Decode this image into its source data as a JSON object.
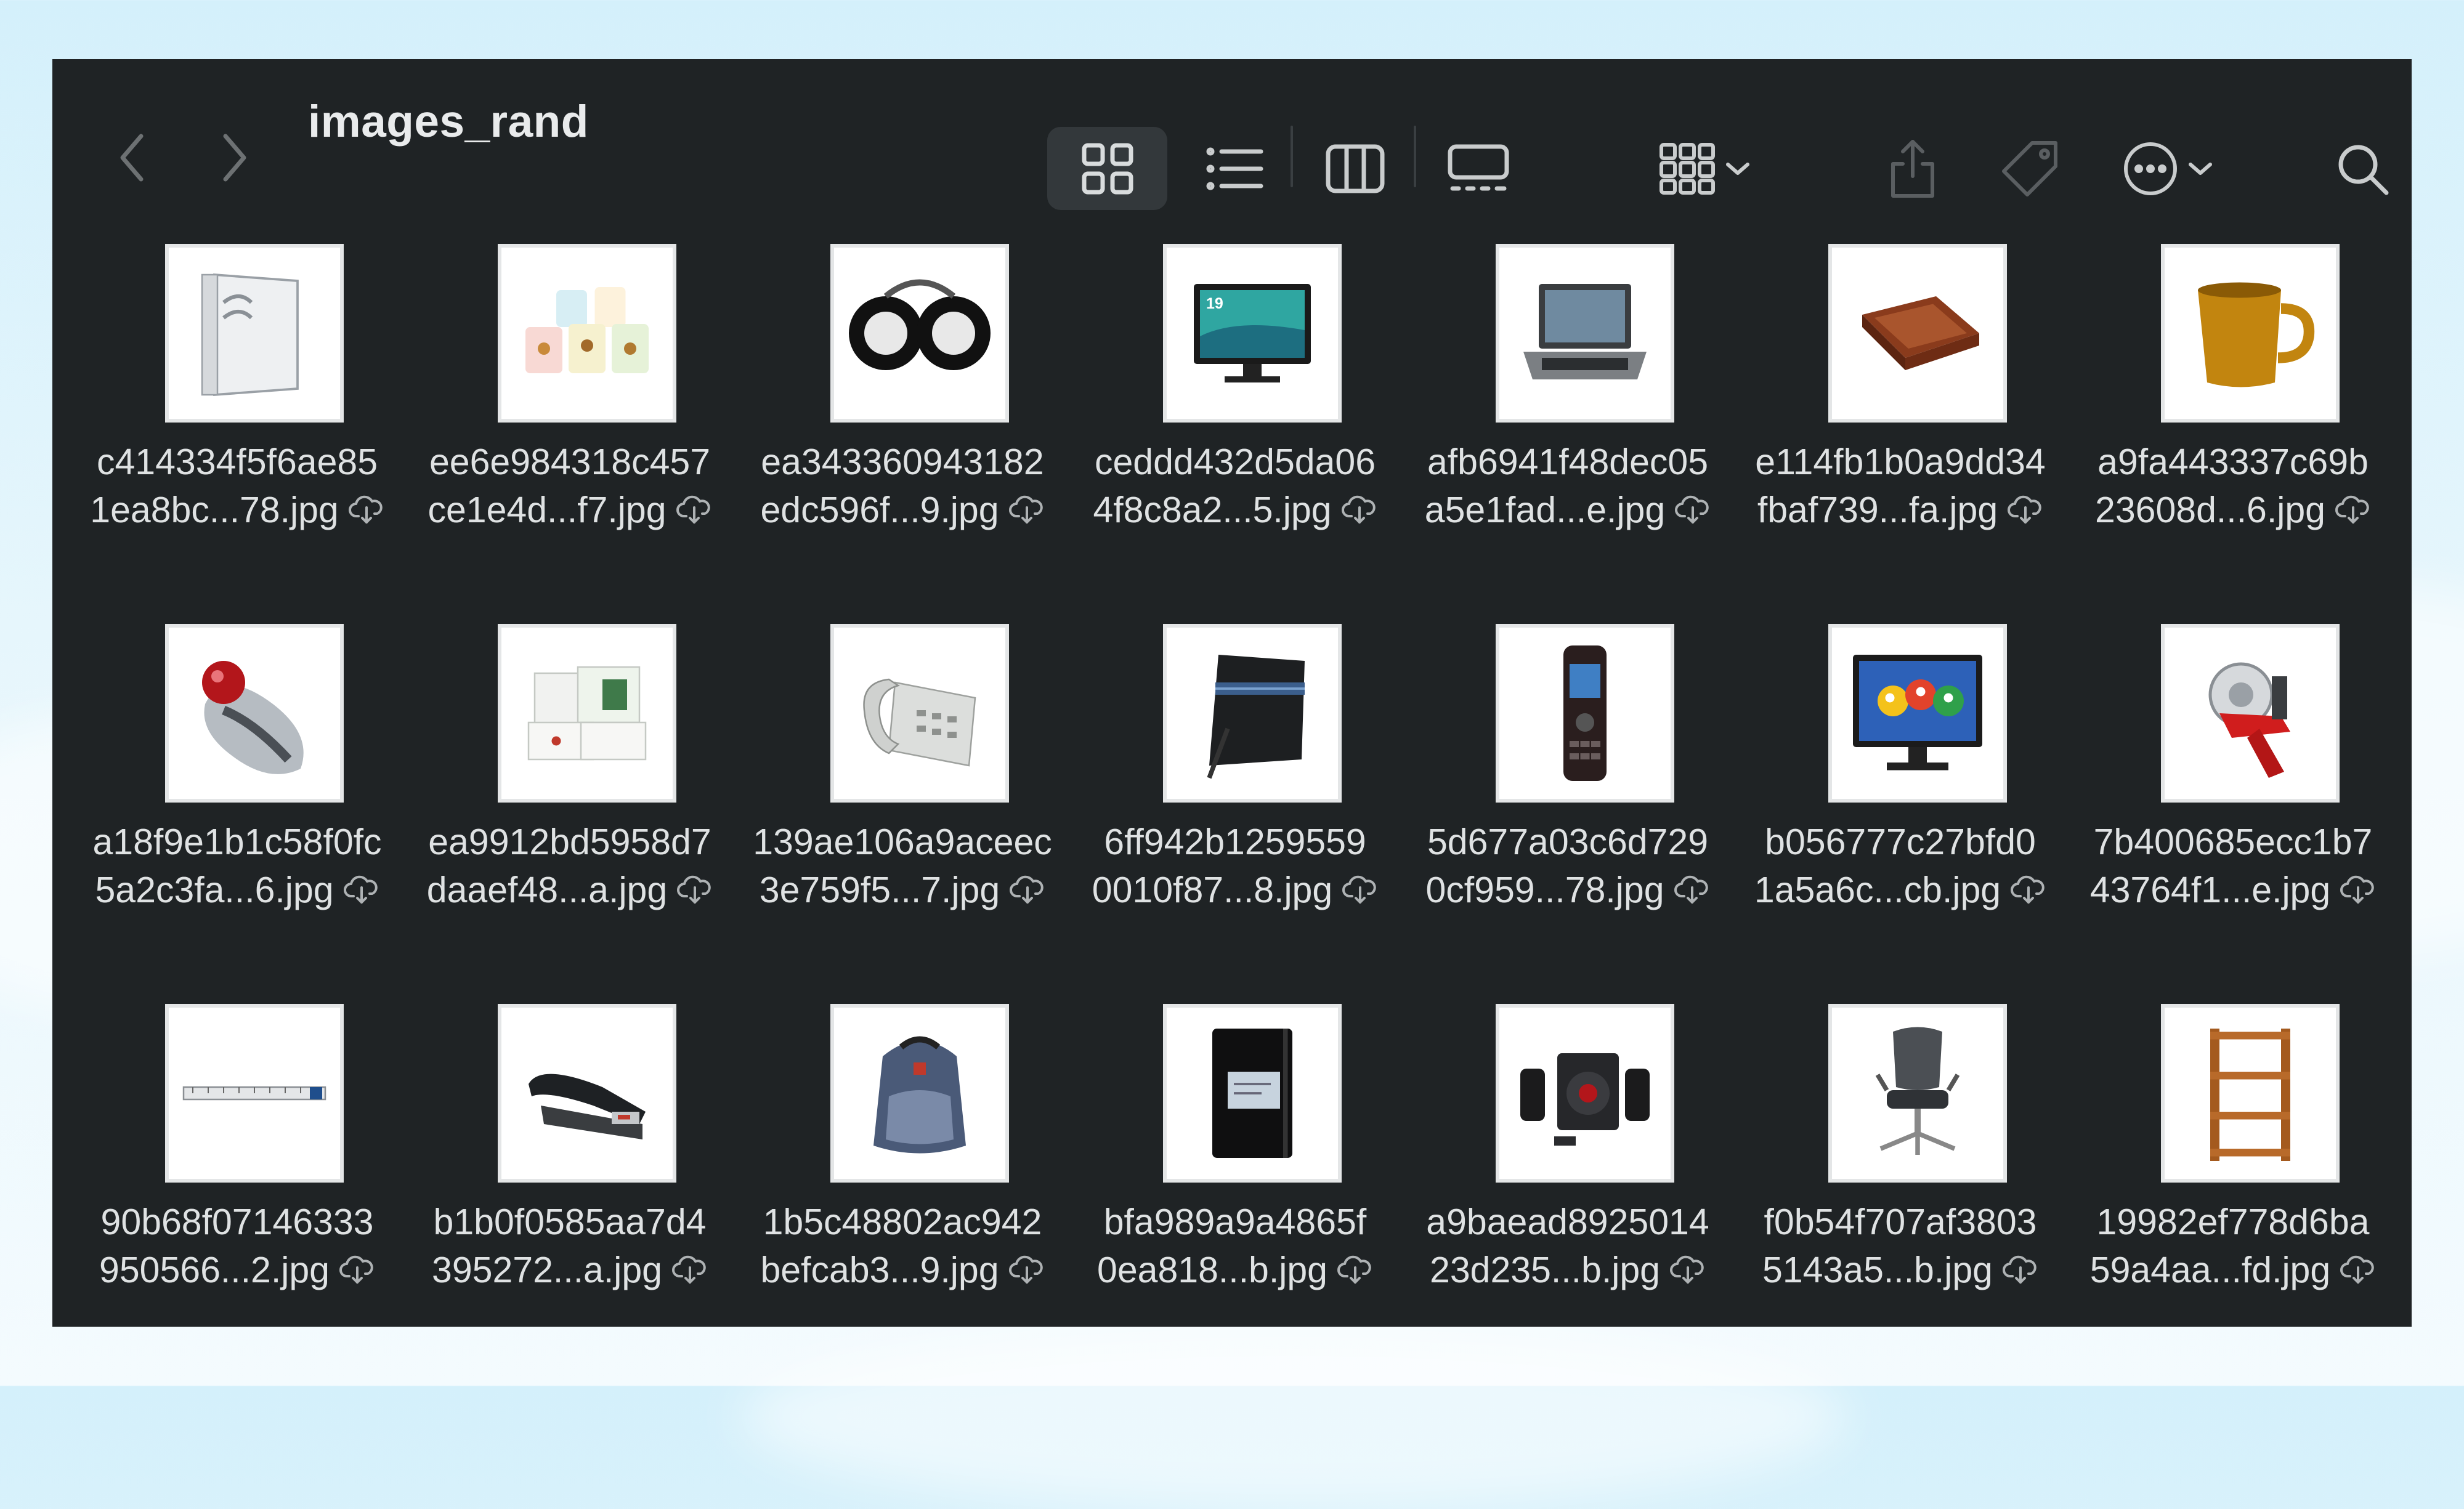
{
  "window": {
    "title": "images_rand",
    "icons": [
      "back-icon",
      "forward-icon",
      "icon-view-icon",
      "list-view-icon",
      "column-view-icon",
      "gallery-view-icon",
      "group-icon",
      "share-icon",
      "tag-icon",
      "more-icon",
      "search-icon"
    ]
  },
  "files": [
    {
      "line1": "c414334f5f6ae85",
      "line2": "1ea8bc...78.jpg",
      "thumb": "binder"
    },
    {
      "line1": "ee6e984318c457",
      "line2": "ce1e4d...f7.jpg",
      "thumb": "mugs"
    },
    {
      "line1": "ea343360943182",
      "line2": "edc596f...9.jpg",
      "thumb": "headphones"
    },
    {
      "line1": "ceddd432d5da06",
      "line2": "4f8c8a2...5.jpg",
      "thumb": "monitor-19"
    },
    {
      "line1": "afb6941f48dec05",
      "line2": "a5e1fad...e.jpg",
      "thumb": "laptop"
    },
    {
      "line1": "e114fb1b0a9dd34",
      "line2": "fbaf739...fa.jpg",
      "thumb": "desk-tray"
    },
    {
      "line1": "a9fa443337c69b",
      "line2": "23608d...6.jpg",
      "thumb": "yellow-mug"
    },
    {
      "line1": "a18f9e1b1c58f0fc",
      "line2": "5a2c3fa...6.jpg",
      "thumb": "trackball"
    },
    {
      "line1": "ea9912bd5958d7",
      "line2": "daaef48...a.jpg",
      "thumb": "cards"
    },
    {
      "line1": "139ae106a9aceec",
      "line2": "3e759f5...7.jpg",
      "thumb": "desk-phone"
    },
    {
      "line1": "6ff942b1259559",
      "line2": "0010f87...8.jpg",
      "thumb": "copyholder"
    },
    {
      "line1": "5d677a03c6d729",
      "line2": "0cf959...78.jpg",
      "thumb": "cellphone"
    },
    {
      "line1": "b056777c27bfd0",
      "line2": "1a5a6c...cb.jpg",
      "thumb": "monitor-birds"
    },
    {
      "line1": "7b400685ecc1b7",
      "line2": "43764f1...e.jpg",
      "thumb": "tape-gun"
    },
    {
      "line1": "90b68f07146333",
      "line2": "950566...2.jpg",
      "thumb": "ruler"
    },
    {
      "line1": "b1b0f0585aa7d4",
      "line2": "395272...a.jpg",
      "thumb": "stapler"
    },
    {
      "line1": "1b5c48802ac942",
      "line2": "befcab3...9.jpg",
      "thumb": "backpack"
    },
    {
      "line1": "bfa989a9a4865f",
      "line2": "0ea818...b.jpg",
      "thumb": "notebook"
    },
    {
      "line1": "a9baead8925014",
      "line2": "23d235...b.jpg",
      "thumb": "speakers"
    },
    {
      "line1": "f0b54f707af3803",
      "line2": "5143a5...b.jpg",
      "thumb": "office-chair"
    },
    {
      "line1": "19982ef778d6ba",
      "line2": "59a4aa...fd.jpg",
      "thumb": "bookshelf"
    }
  ]
}
